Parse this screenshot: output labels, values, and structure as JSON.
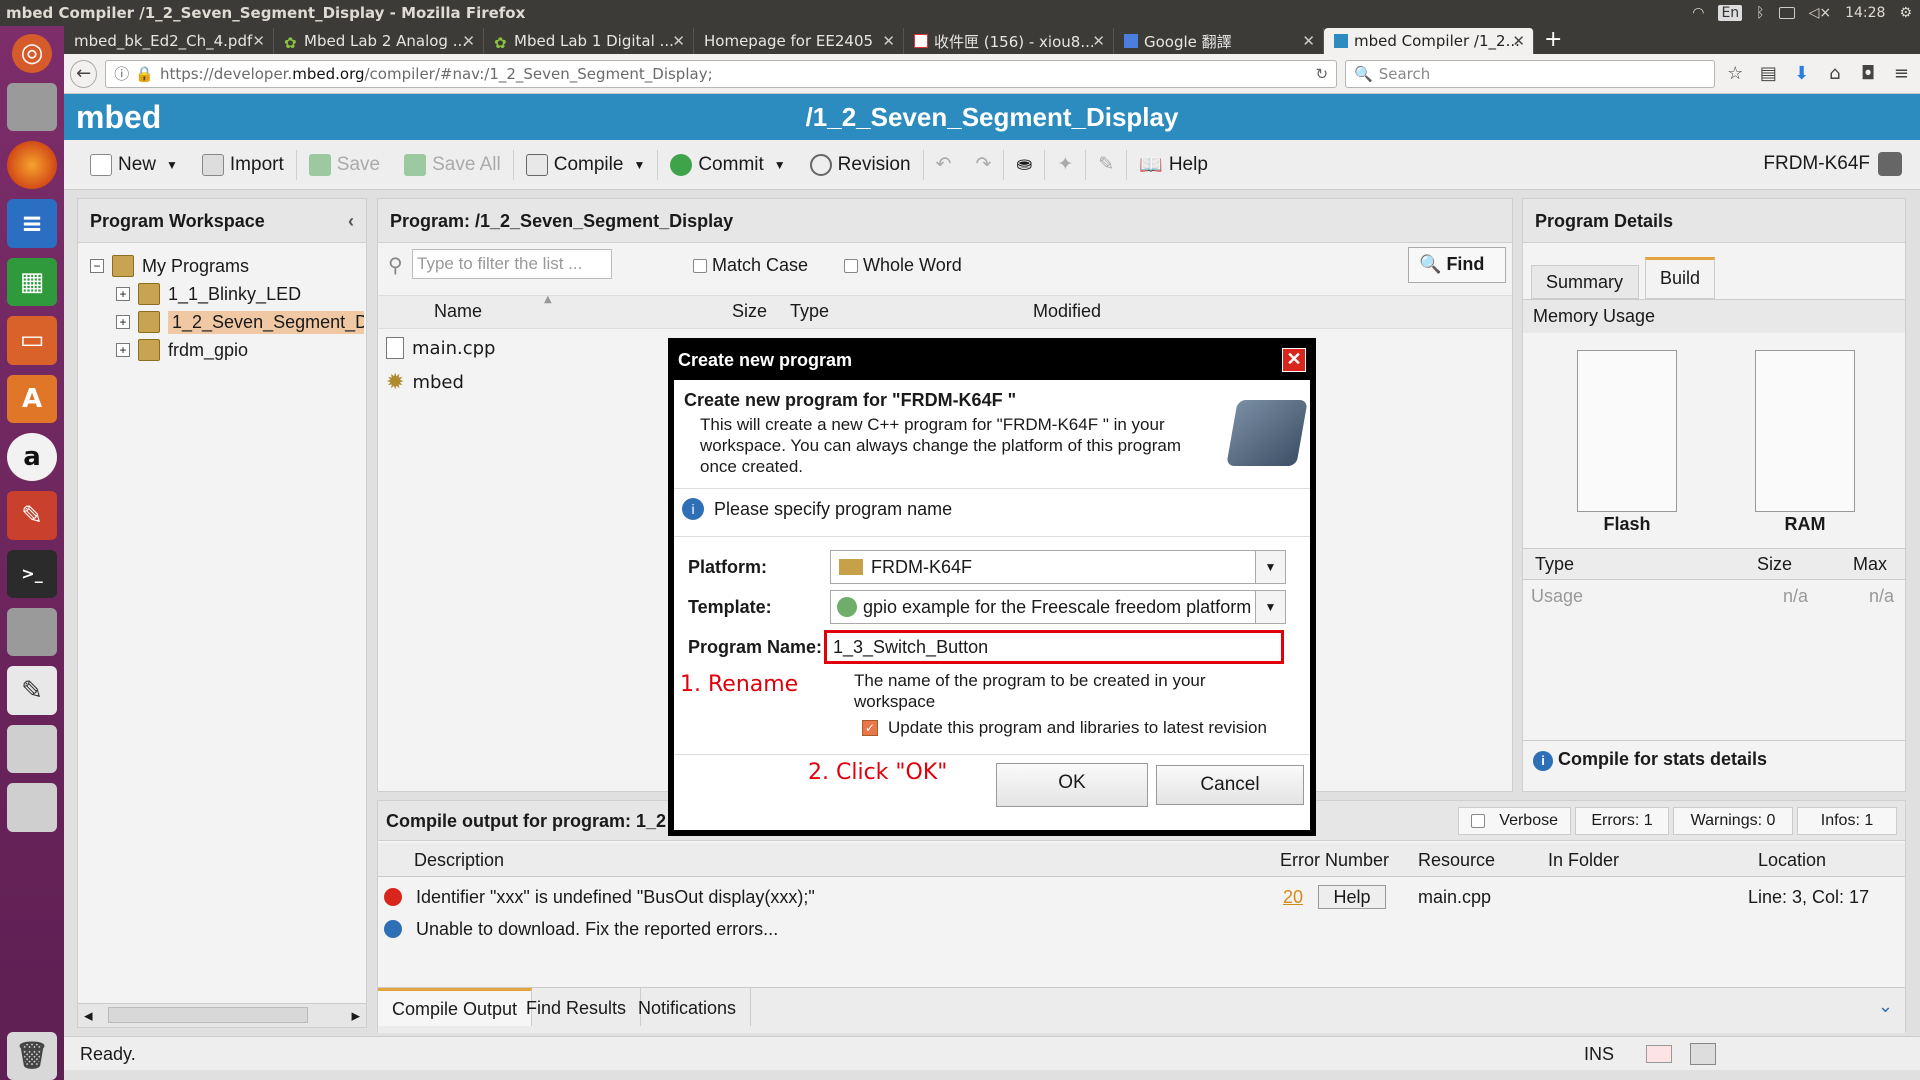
{
  "window_title": "mbed Compiler /1_2_Seven_Segment_Display - Mozilla Firefox",
  "system_tray": {
    "lang": "En",
    "time": "14:28"
  },
  "tabs": [
    {
      "label": "mbed_bk_Ed2_Ch_4.pdf"
    },
    {
      "label": "Mbed Lab 2 Analog ..."
    },
    {
      "label": "Mbed Lab 1 Digital ..."
    },
    {
      "label": "Homepage for EE2405"
    },
    {
      "label": "收件匣 (156) - xiou8..."
    },
    {
      "label": "Google 翻譯"
    },
    {
      "label": "mbed Compiler /1_2..."
    }
  ],
  "url": {
    "prefix": "https://developer.",
    "domain": "mbed.org",
    "path": "/compiler/#nav:/1_2_Seven_Segment_Display;"
  },
  "search_placeholder": "Search",
  "app": {
    "logo": "mbed",
    "program_title": "/1_2_Seven_Segment_Display"
  },
  "toolbar": {
    "new": "New",
    "import": "Import",
    "save": "Save",
    "save_all": "Save All",
    "compile": "Compile",
    "commit": "Commit",
    "revision": "Revision",
    "help": "Help",
    "platform": "FRDM-K64F"
  },
  "workspace": {
    "title": "Program Workspace",
    "root": "My Programs",
    "items": [
      "1_1_Blinky_LED",
      "1_2_Seven_Segment_D",
      "frdm_gpio"
    ]
  },
  "program_panel": {
    "title": "Program: /1_2_Seven_Segment_Display",
    "filter_placeholder": "Type to filter the list ...",
    "match_case": "Match Case",
    "whole_word": "Whole Word",
    "find": "Find",
    "columns": [
      "Name",
      "Size",
      "Type",
      "Modified"
    ],
    "files": [
      "main.cpp",
      "mbed"
    ]
  },
  "details": {
    "title": "Program Details",
    "tabs": [
      "Summary",
      "Build"
    ],
    "memory_usage": "Memory Usage",
    "flash": "Flash",
    "ram": "RAM",
    "columns": [
      "Type",
      "Size",
      "Max"
    ],
    "usage_row": [
      "Usage",
      "n/a",
      "n/a"
    ],
    "compile_hint": "Compile for stats details"
  },
  "compile_output": {
    "title": "Compile output for program: 1_2",
    "verbose": "Verbose",
    "errors": "Errors: 1",
    "warnings": "Warnings: 0",
    "infos": "Infos: 1",
    "columns": [
      "Description",
      "Error Number",
      "Resource",
      "In Folder",
      "Location"
    ],
    "rows": [
      {
        "description": "Identifier \"xxx\" is undefined \"BusOut display(xxx);\"",
        "error_number": "20",
        "help": "Help",
        "resource": "main.cpp",
        "location": "Line: 3, Col: 17"
      },
      {
        "description": "Unable to download. Fix the reported errors..."
      }
    ],
    "bottom_tabs": [
      "Compile Output",
      "Find Results",
      "Notifications"
    ]
  },
  "status": {
    "text": "Ready.",
    "ins": "INS"
  },
  "dialog": {
    "title": "Create new program",
    "heading": "Create new program for \"FRDM-K64F \"",
    "description": "This will create a new C++ program for \"FRDM-K64F \" in your workspace. You can always change the platform of this program once created.",
    "info": "Please specify program name",
    "platform_label": "Platform:",
    "platform_value": "FRDM-K64F",
    "template_label": "Template:",
    "template_value": "gpio example for the Freescale freedom platform",
    "name_label": "Program Name:",
    "name_value": "1_3_Switch_Button",
    "name_hint": "The name of the program to be created in your workspace",
    "update_label": "Update this program and libraries to latest revision",
    "ok": "OK",
    "cancel": "Cancel",
    "annotation_1": "1. Rename",
    "annotation_2": "2. Click \"OK\""
  }
}
